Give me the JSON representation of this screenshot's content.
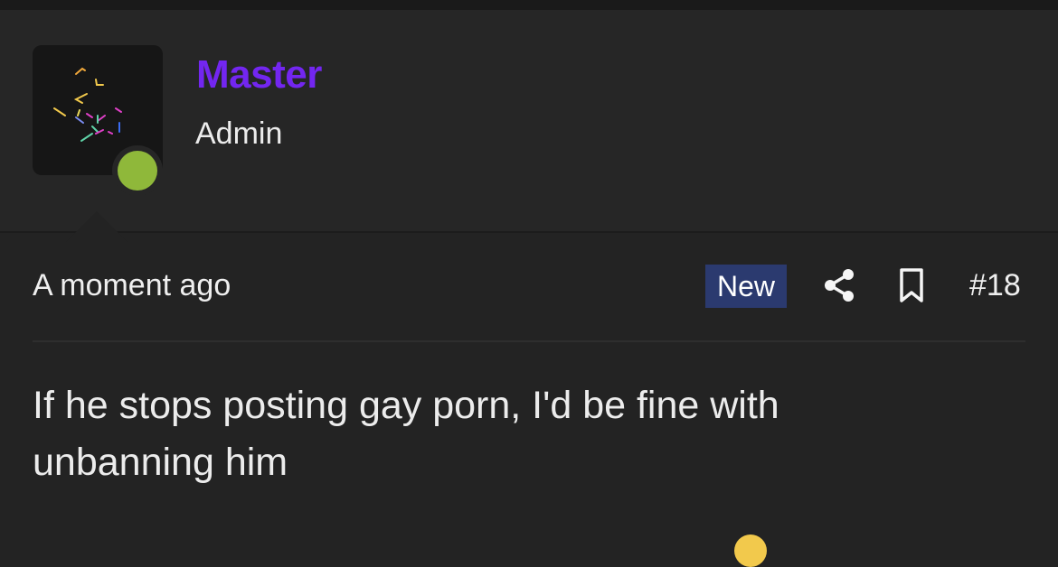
{
  "author": {
    "username": "Master",
    "role": "Admin",
    "username_color": "#7326f0",
    "status": "online",
    "status_color": "#8fb83a"
  },
  "post": {
    "timestamp": "A moment ago",
    "badge": "New",
    "badge_color": "#2b3a6f",
    "number": "#18",
    "actions": [
      "share-icon",
      "bookmark-icon"
    ],
    "body": "If he stops posting gay porn, I'd be fine with unbanning him"
  }
}
